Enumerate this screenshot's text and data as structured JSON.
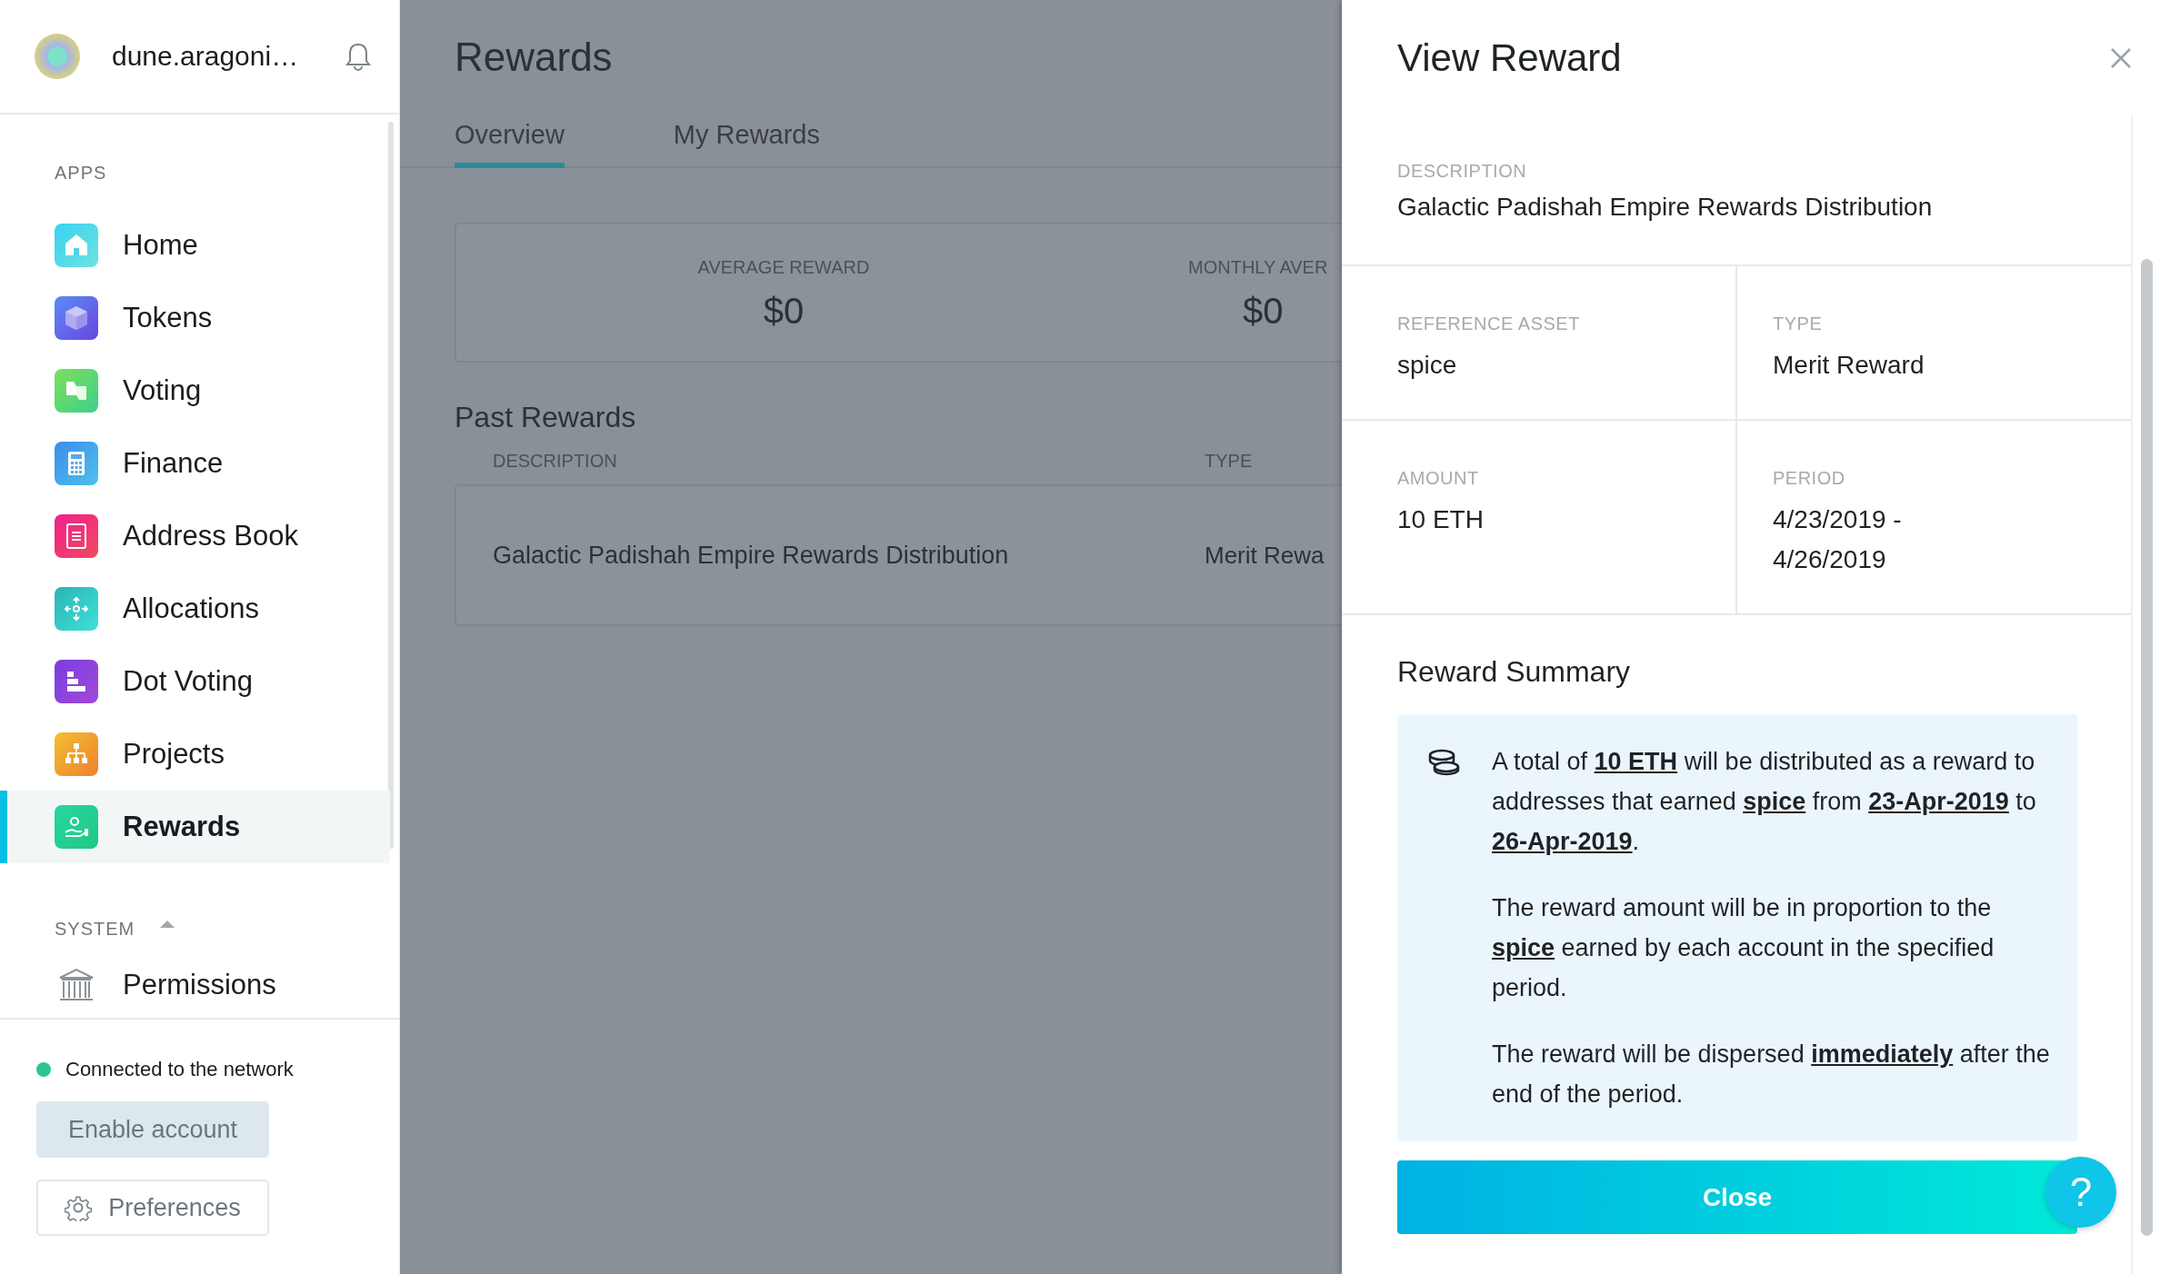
{
  "sidebar": {
    "account_name": "dune.aragoni…",
    "apps_heading": "APPS",
    "apps": [
      {
        "label": "Home",
        "selected": false
      },
      {
        "label": "Tokens",
        "selected": false
      },
      {
        "label": "Voting",
        "selected": false
      },
      {
        "label": "Finance",
        "selected": false
      },
      {
        "label": "Address Book",
        "selected": false
      },
      {
        "label": "Allocations",
        "selected": false
      },
      {
        "label": "Dot Voting",
        "selected": false
      },
      {
        "label": "Projects",
        "selected": false
      },
      {
        "label": "Rewards",
        "selected": true
      }
    ],
    "system_heading": "SYSTEM",
    "system_expanded": true,
    "system_items": [
      {
        "label": "Permissions",
        "selected": false
      }
    ],
    "network": {
      "connected": true,
      "label": "Connected to the network"
    },
    "enable_button": "Enable account",
    "preferences_button": "Preferences"
  },
  "main": {
    "title": "Rewards",
    "tabs": [
      {
        "label": "Overview",
        "selected": true
      },
      {
        "label": "My Rewards",
        "selected": false
      }
    ],
    "stats": [
      {
        "label": "AVERAGE REWARD",
        "value": "$0"
      },
      {
        "label": "MONTHLY AVER",
        "value": "$0"
      }
    ],
    "past_rewards": {
      "title": "Past Rewards",
      "columns": [
        "DESCRIPTION",
        "TYPE"
      ],
      "rows": [
        [
          "Galactic Padishah Empire Rewards Distribution",
          "Merit Rewa"
        ]
      ]
    }
  },
  "panel": {
    "title": "View Reward",
    "fields": [
      {
        "label": "DESCRIPTION",
        "value": "Galactic Padishah Empire Rewards Distribution"
      },
      {
        "label": "REFERENCE ASSET",
        "value": "spice"
      },
      {
        "label": "TYPE",
        "value": "Merit Reward"
      },
      {
        "label": "AMOUNT",
        "value": "10 ETH"
      },
      {
        "label": "PERIOD",
        "value": "4/23/2019 -\n4/26/2019"
      }
    ],
    "summary_title": "Reward Summary",
    "summary": [
      "A total of **10 ETH** will be distributed as a reward to addresses that earned **spice** from **23-Apr-2019** to **26-Apr-2019**.",
      "The reward amount will be in proportion to the **spice** earned by each account in the specified period.",
      "The reward will be dispersed **immediately** after the end of the period."
    ],
    "close_button": "Close",
    "help_button": "?"
  }
}
